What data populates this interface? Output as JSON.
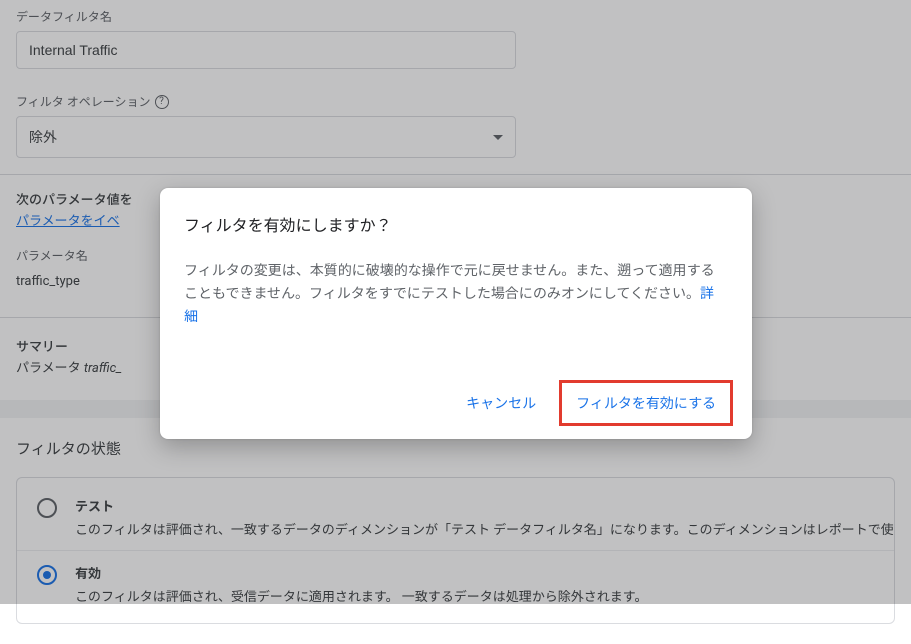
{
  "filterName": {
    "label": "データフィルタ名",
    "value": "Internal Traffic"
  },
  "filterOperation": {
    "label": "フィルタ オペレーション",
    "value": "除外"
  },
  "paramBlock": {
    "title": "次のパラメータ値を",
    "linkText": "パラメータをイベ",
    "colParam": "パラメータ名",
    "paramValue": "traffic_type"
  },
  "summary": {
    "heading": "サマリー",
    "prefix": "パラメータ ",
    "paramItalic": "traffic_"
  },
  "state": {
    "heading": "フィルタの状態",
    "options": [
      {
        "id": "test",
        "title": "テスト",
        "desc": "このフィルタは評価され、一致するデータのディメンションが「テスト データフィルタ名」になります。このディメンションはレポートで使",
        "selected": false
      },
      {
        "id": "active",
        "title": "有効",
        "desc": "このフィルタは評価され、受信データに適用されます。 一致するデータは処理から除外されます。",
        "selected": true
      }
    ]
  },
  "dialog": {
    "title": "フィルタを有効にしますか？",
    "body": "フィルタの変更は、本質的に破壊的な操作で元に戻せません。また、遡って適用することもできません。フィルタをすでにテストした場合にのみオンにしてください。",
    "detailsLink": "詳細",
    "cancel": "キャンセル",
    "confirm": "フィルタを有効にする"
  }
}
